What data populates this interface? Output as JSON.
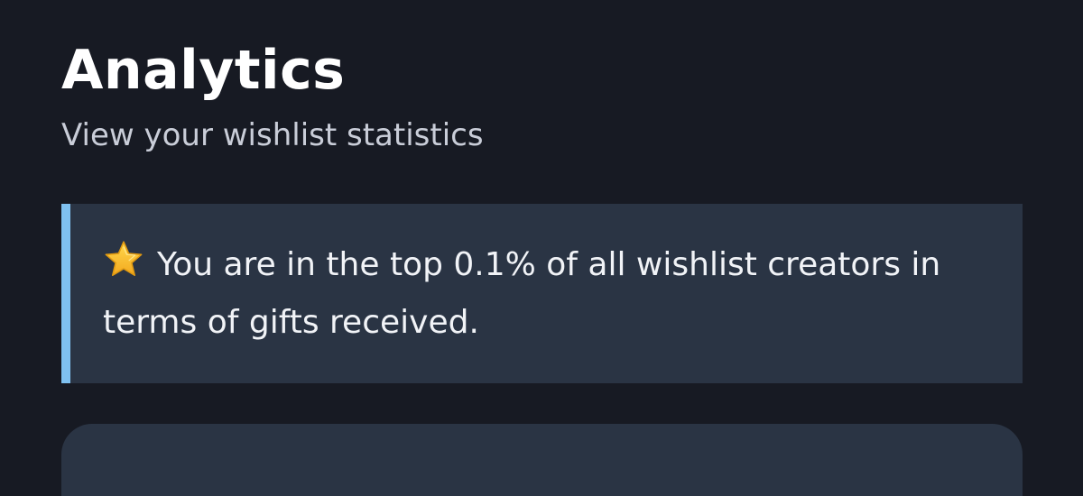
{
  "header": {
    "title": "Analytics",
    "subtitle": "View your wishlist statistics"
  },
  "callout": {
    "icon": "star-icon",
    "text": "You are in the top 0.1% of all wishlist creators in terms of gifts received.",
    "accent_color": "#7fc1f0",
    "background_color": "#2a3444"
  },
  "colors": {
    "page_background": "#171a23",
    "title": "#ffffff",
    "subtitle": "#c9cdd8",
    "card_background": "#2a3444"
  }
}
